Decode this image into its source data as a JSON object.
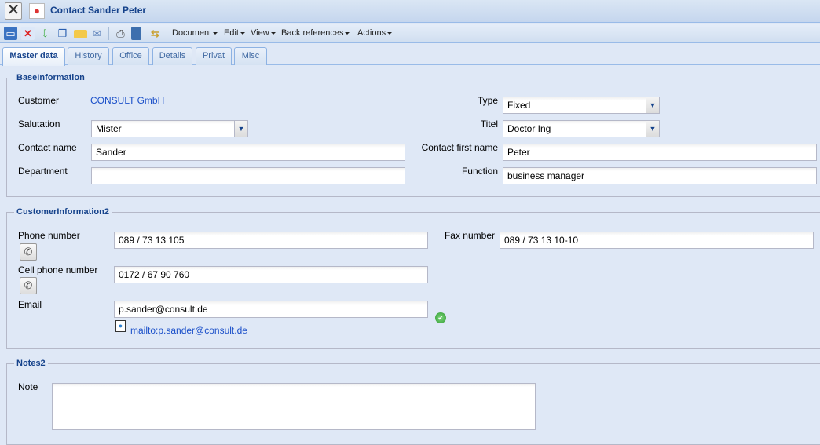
{
  "window": {
    "title": "Contact Sander Peter",
    "icon": "contact-person-icon",
    "close_icon": "close-icon"
  },
  "toolbar": {
    "icons": [
      "save-icon",
      "delete-icon",
      "import-icon",
      "copy-icon",
      "folder-icon",
      "mail-icon",
      "print-icon",
      "book-icon",
      "swap-icon"
    ],
    "menus": [
      "Document",
      "Edit",
      "View",
      "Back references",
      "Actions"
    ]
  },
  "tabs": [
    {
      "label": "Master data",
      "active": true
    },
    {
      "label": "History"
    },
    {
      "label": "Office"
    },
    {
      "label": "Details"
    },
    {
      "label": "Privat"
    },
    {
      "label": "Misc"
    }
  ],
  "base": {
    "legend": "BaseInformation",
    "customer_label": "Customer",
    "customer_value": "CONSULT GmbH",
    "salutation_label": "Salutation",
    "salutation_value": "Mister",
    "contact_name_label": "Contact name",
    "contact_name_value": "Sander",
    "department_label": "Department",
    "department_value": "",
    "type_label": "Type",
    "type_value": "Fixed",
    "titel_label": "Titel",
    "titel_value": "Doctor Ing",
    "first_name_label": "Contact first name",
    "first_name_value": "Peter",
    "function_label": "Function",
    "function_value": "business manager"
  },
  "customer_info": {
    "legend": "CustomerInformation2",
    "phone_label": "Phone number",
    "phone_value": "089 / 73 13 105",
    "cell_label": "Cell phone number",
    "cell_value": "0172 / 67 90 760",
    "email_label": "Email",
    "email_value": "p.sander@consult.de",
    "mailto": "mailto:p.sander@consult.de",
    "fax_label": "Fax number",
    "fax_value": "089 / 73 13 10-10"
  },
  "notes": {
    "legend": "Notes2",
    "note_label": "Note",
    "note_value": ""
  },
  "colors": {
    "background": "#dfe8f6",
    "heading": "#15428b",
    "link": "#1a4fc9",
    "valid": "#3fae3f"
  }
}
